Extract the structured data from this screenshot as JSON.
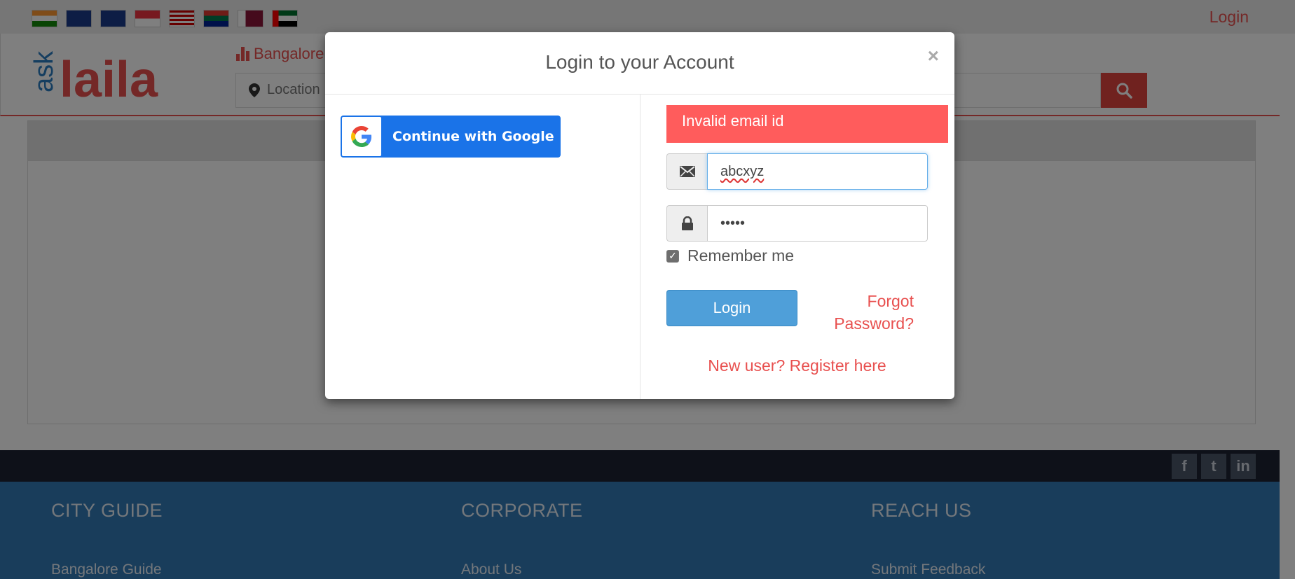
{
  "topbar": {
    "flags": [
      "India",
      "Australia",
      "New Zealand",
      "Singapore",
      "Malaysia",
      "South Africa",
      "Qatar",
      "UAE"
    ],
    "login_label": "Login"
  },
  "header": {
    "logo": {
      "ask": "ask",
      "laila": "laila"
    },
    "city": "Bangalore",
    "location_placeholder": "Location",
    "search_icon": "search-icon"
  },
  "footer": {
    "columns": [
      {
        "heading": "CITY GUIDE",
        "first_link": "Bangalore Guide"
      },
      {
        "heading": "CORPORATE",
        "first_link": "About Us"
      },
      {
        "heading": "REACH US",
        "first_link": "Submit Feedback"
      }
    ],
    "social": [
      "f",
      "t",
      "in"
    ]
  },
  "modal": {
    "title": "Login to your Account",
    "close": "×",
    "google_label": "Continue with Google",
    "error": "Invalid email id",
    "email_value": "abcxyz",
    "password_value": "•••••",
    "remember_label": "Remember me",
    "remember_checked": true,
    "login_button": "Login",
    "forgot_line1": "Forgot",
    "forgot_line2": "Password?",
    "register_link": "New user? Register here"
  },
  "colors": {
    "brand_red": "#e8504f",
    "brand_blue": "#337ab7",
    "google_blue": "#1a73e8",
    "error_red": "#ff5c5c",
    "login_blue": "#4f9fd9"
  }
}
